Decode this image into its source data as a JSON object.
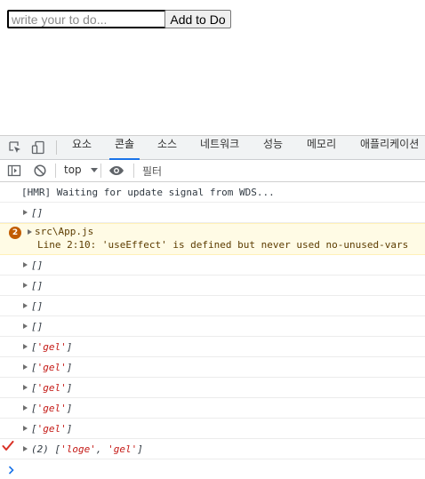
{
  "app": {
    "input_placeholder": "write your to do...",
    "input_value": "",
    "add_button_label": "Add to Do"
  },
  "devtools": {
    "tabs": [
      {
        "label": "요소"
      },
      {
        "label": "콘솔",
        "active": true
      },
      {
        "label": "소스"
      },
      {
        "label": "네트워크"
      },
      {
        "label": "성능"
      },
      {
        "label": "메모리"
      },
      {
        "label": "애플리케이션"
      }
    ],
    "context_select": "top",
    "filter_placeholder": "필터",
    "accent_color": "#1a73e8"
  },
  "console": {
    "hmr_message": "[HMR] Waiting for update signal from WDS...",
    "empty_array": "[]",
    "warning": {
      "count": "2",
      "file": "src\\App.js",
      "message": "Line 2:10:  'useEffect' is defined but never used  no-unused-vars"
    },
    "gel_log": {
      "open": "[",
      "value": "'gel'",
      "close": "]"
    },
    "last_log": {
      "count": "(2)",
      "open": "[",
      "value1": "'loge'",
      "sep": ", ",
      "value2": "'gel'",
      "close": "]"
    }
  }
}
